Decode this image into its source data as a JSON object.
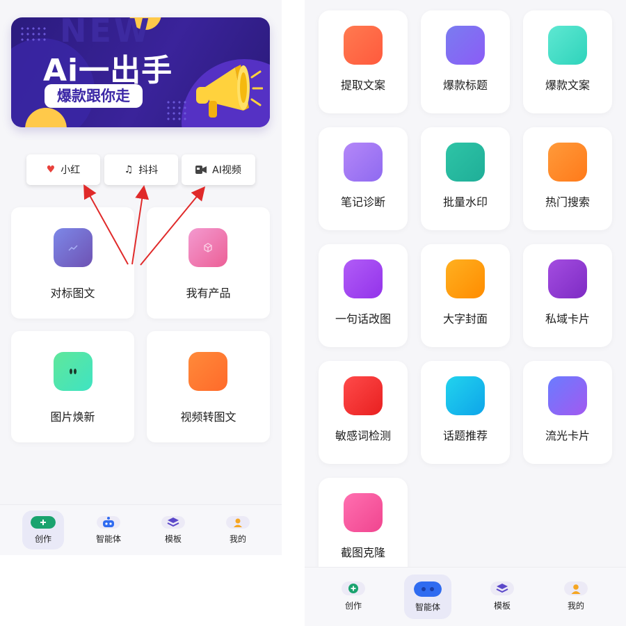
{
  "left": {
    "banner": {
      "bg_word": "NEW",
      "title": "Ai一出手",
      "subtitle": "爆款跟你走"
    },
    "platform_tabs": [
      {
        "label": "小红",
        "icon": "heart-icon",
        "color": "#e8413b"
      },
      {
        "label": "抖抖",
        "icon": "music-note-icon",
        "color": "#222222"
      },
      {
        "label": "AI视频",
        "icon": "video-camera-icon",
        "color": "#444444"
      }
    ],
    "cards": [
      {
        "label": "对标图文",
        "icon": "trend-chart-icon",
        "gradient": [
          "#7d88e8",
          "#6e52b3"
        ]
      },
      {
        "label": "我有产品",
        "icon": "box-icon",
        "gradient": [
          "#f39ad0",
          "#ec5f96"
        ]
      },
      {
        "label": "图片焕新",
        "icon": "sparkle-icon",
        "gradient": [
          "#5fe79b",
          "#3fe3c2"
        ]
      },
      {
        "label": "视频转图文",
        "icon": "video-icon",
        "gradient": [
          "#ff8a3a",
          "#ff6a2a"
        ]
      }
    ],
    "nav": [
      {
        "label": "创作",
        "icon": "plus-circle-icon",
        "active": true
      },
      {
        "label": "智能体",
        "icon": "robot-icon",
        "active": false
      },
      {
        "label": "模板",
        "icon": "layers-icon",
        "active": false
      },
      {
        "label": "我的",
        "icon": "user-icon",
        "active": false
      }
    ]
  },
  "right": {
    "tools": [
      {
        "label": "提取文案",
        "gradient": [
          "#ff7a50",
          "#ff5a3d"
        ]
      },
      {
        "label": "爆款标题",
        "gradient": [
          "#7a7cf0",
          "#8b5cf6"
        ]
      },
      {
        "label": "爆款文案",
        "gradient": [
          "#5ee8d2",
          "#2fd3bb"
        ]
      },
      {
        "label": "笔记诊断",
        "gradient": [
          "#b487f8",
          "#8f6af0"
        ]
      },
      {
        "label": "批量水印",
        "gradient": [
          "#2ec4a6",
          "#1fae98"
        ]
      },
      {
        "label": "热门搜索",
        "gradient": [
          "#ff9a3a",
          "#ff7a1a"
        ]
      },
      {
        "label": "一句话改图",
        "gradient": [
          "#b15cf7",
          "#9333ea"
        ]
      },
      {
        "label": "大字封面",
        "gradient": [
          "#ffb020",
          "#ff8c00"
        ]
      },
      {
        "label": "私域卡片",
        "gradient": [
          "#a34de0",
          "#7e2bc4"
        ]
      },
      {
        "label": "敏感词检测",
        "gradient": [
          "#ff4a4a",
          "#e82020"
        ]
      },
      {
        "label": "话题推荐",
        "gradient": [
          "#22d3ee",
          "#0ea5e9"
        ]
      },
      {
        "label": "流光卡片",
        "gradient": [
          "#6a7cff",
          "#a259f0"
        ]
      },
      {
        "label": "截图克隆",
        "gradient": [
          "#ff6fb0",
          "#f0458f"
        ]
      }
    ],
    "nav": [
      {
        "label": "创作",
        "icon": "plus-circle-icon",
        "active": false
      },
      {
        "label": "智能体",
        "icon": "robot-icon",
        "active": true
      },
      {
        "label": "模板",
        "icon": "layers-icon",
        "active": false
      },
      {
        "label": "我的",
        "icon": "user-icon",
        "active": false
      }
    ]
  },
  "colors": {
    "accent_green": "#1aa36f",
    "accent_blue": "#2f6bf0",
    "accent_orange": "#f5a623",
    "accent_purple": "#5b48c9",
    "arrow_red": "#e02a2a"
  }
}
